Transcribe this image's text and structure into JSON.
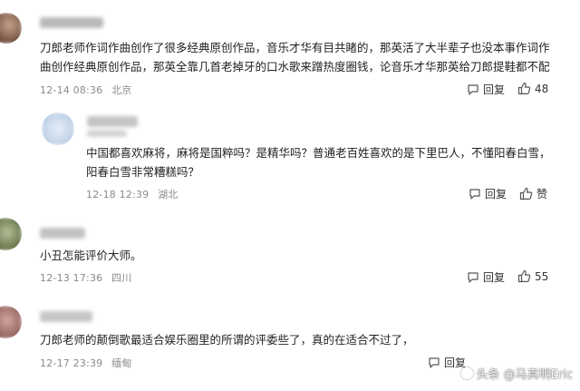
{
  "comments": [
    {
      "text_line1": "刀郎老师作词作曲创作了很多经典原创作品，音乐才华有目共睹的，那英活了大半辈子也没本事作词作",
      "text_line2": "曲创作经典原创作品，那英全靠几首老掉牙的口水歌来蹭热度圈钱，论音乐才华那英给刀郎提鞋都不配",
      "date": "12-14 08:36",
      "location": "北京",
      "reply_label": "回复",
      "like_count": "48"
    },
    {
      "text_line1": "中国都喜欢麻将，麻将是国粹吗？是精华吗？普通老百姓喜欢的是下里巴人，不懂阳春白雪，",
      "text_line2": "阳春白雪非常糟糕吗？",
      "date": "12-18 12:39",
      "location": "湖北",
      "reply_label": "回复",
      "like_count": "赞"
    },
    {
      "text_line1": "小丑怎能评价大师。",
      "date": "12-13 17:36",
      "location": "四川",
      "reply_label": "回复",
      "like_count": "55"
    },
    {
      "text_line1": "刀郎老师的颠倒歌最适合娱乐圈里的所谓的评委些了，真的在适合不过了，",
      "date": "12-17 23:39",
      "location": "缅甸",
      "reply_label": "回复"
    }
  ],
  "watermark": "头条 @马真明Eric",
  "colors": {
    "meta": "#8a8a8a",
    "text": "#222222"
  }
}
